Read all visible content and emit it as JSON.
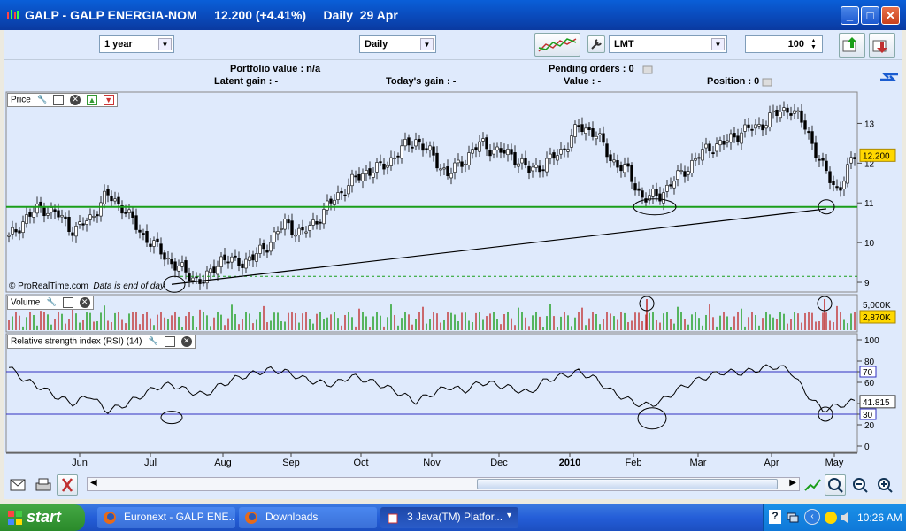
{
  "window": {
    "title": "GALP - GALP ENERGIA-NOM     12.200 (+4.41%)     Daily  29 Apr",
    "controls": {
      "minimize": "_",
      "maximize": "□",
      "close": "✕"
    }
  },
  "toolbar": {
    "period_select": "1 year",
    "interval_select": "Daily",
    "order_type_select": "LMT",
    "quantity_input": "100"
  },
  "info": {
    "portfolio_value": "Portfolio value : n/a",
    "pending_orders": "Pending orders : 0",
    "latent_gain": "Latent gain : -",
    "todays_gain": "Today's gain : -",
    "value": "Value : -",
    "position": "Position : 0"
  },
  "panels": {
    "price": {
      "label": "Price",
      "watermark": "© ProRealTime.com",
      "watermark_note": "Data is end of day",
      "last_tag": "12.200",
      "y_ticks": [
        "13",
        "12",
        "11",
        "10",
        "9"
      ]
    },
    "volume": {
      "label": "Volume",
      "top_tick": "5,000K",
      "last_tag": "2,870K"
    },
    "rsi": {
      "label": "Relative strength index (RSI) (14)",
      "last_tag": "41.815",
      "y_ticks": [
        "100",
        "80",
        "70",
        "60",
        "40",
        "30",
        "20",
        "0"
      ],
      "overbought": "70",
      "oversold": "30"
    }
  },
  "colors": {
    "up": "#1a9e1a",
    "down": "#c03030",
    "support": "#1a9e1a",
    "rsi_band": "#3030c0",
    "panel_bg": "#dfeafc",
    "tag_bg": "#ffd800"
  },
  "chart_data": {
    "type": "candlestick",
    "x_labels": [
      "Jun",
      "Jul",
      "Aug",
      "Sep",
      "Oct",
      "Nov",
      "Dec",
      "2010",
      "Feb",
      "Mar",
      "Apr",
      "May"
    ],
    "price_close_approx": [
      10.1,
      10.6,
      10.9,
      10.7,
      10.3,
      10.6,
      11.2,
      10.9,
      10.3,
      9.9,
      9.5,
      9.2,
      9.0,
      9.6,
      9.5,
      9.6,
      10.0,
      10.5,
      10.2,
      10.6,
      11.1,
      11.5,
      11.8,
      11.9,
      12.3,
      12.6,
      12.2,
      11.7,
      12.1,
      12.5,
      12.3,
      12.2,
      11.8,
      12.0,
      12.3,
      12.9,
      12.8,
      12.1,
      11.8,
      11.1,
      11.2,
      11.6,
      12.0,
      12.4,
      12.5,
      12.8,
      12.9,
      13.2,
      13.4,
      12.9,
      11.9,
      11.3,
      12.2
    ],
    "price_ylim": [
      8.8,
      13.7
    ],
    "support_level": 10.9,
    "dashed_level": 9.15,
    "rsi_approx": [
      74,
      62,
      55,
      46,
      40,
      48,
      33,
      38,
      46,
      55,
      58,
      52,
      48,
      57,
      64,
      68,
      72,
      70,
      64,
      60,
      58,
      66,
      62,
      57,
      50,
      42,
      49,
      56,
      52,
      60,
      58,
      54,
      50,
      62,
      66,
      70,
      64,
      52,
      44,
      38,
      41,
      52,
      60,
      66,
      70,
      69,
      72,
      75,
      72,
      50,
      34,
      38,
      42
    ],
    "rsi_ylim": [
      0,
      100
    ],
    "volume_peak": 5000
  },
  "bottom_bar": {},
  "taskbar": {
    "start": "start",
    "tasks": [
      "Euronext - GALP ENE...",
      "Downloads",
      "3 Java(TM) Platfor..."
    ],
    "time": "10:26 AM"
  }
}
